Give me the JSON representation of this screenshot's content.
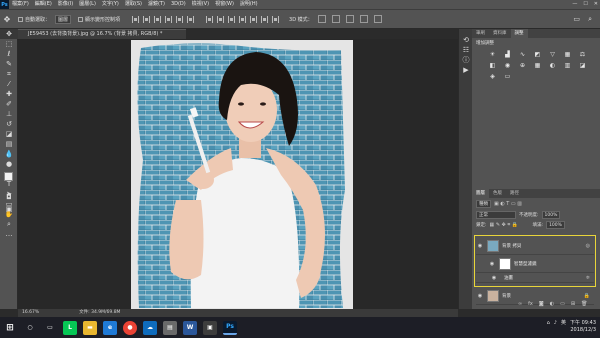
{
  "menubar": {
    "logo": "Ps",
    "items": [
      "檔案(F)",
      "編輯(E)",
      "影像(I)",
      "圖層(L)",
      "文字(Y)",
      "選取(S)",
      "濾鏡(T)",
      "3D(D)",
      "檢視(V)",
      "視窗(W)",
      "說明(H)"
    ],
    "window_controls": [
      "—",
      "☐",
      "✕"
    ]
  },
  "optionsbar": {
    "auto_select_label": "自動選取：",
    "auto_select_value": "圖層",
    "show_transform_label": "顯示變形控制項",
    "mode_label": "3D 模式："
  },
  "document": {
    "tab_title": "JE59453 (去背換背景).jpg @ 16.7% (背景 拷貝, RGB/8) *",
    "zoom": "16.67%",
    "doc_size": "文件: 34.9M/69.8M"
  },
  "panels": {
    "top_tabs": [
      "筆刷",
      "資料庫",
      "調整"
    ],
    "top_active": "調整",
    "adjust_title": "增加調整",
    "layer_tabs": [
      "圖層",
      "色版",
      "路徑"
    ],
    "layer_kind": "種類",
    "blend_mode": "正常",
    "opacity_label": "不透明度:",
    "opacity_value": "100%",
    "lock_label": "鎖定:",
    "fill_label": "填滿:",
    "fill_value": "100%",
    "layers": [
      {
        "name": "背景 拷貝"
      },
      {
        "name": "智慧型濾鏡"
      },
      {
        "name": "油畫"
      },
      {
        "name": "背景"
      }
    ],
    "highlight_color": "#e8d53a"
  },
  "taskbar": {
    "time": "下午 09:43",
    "date": "2018/12/3",
    "lang": "英",
    "apps": [
      {
        "icon": "search-icon",
        "color": "#1d1e26"
      },
      {
        "icon": "task-view-icon",
        "color": "#1d1e26"
      },
      {
        "icon": "line-app-icon",
        "color": "#06c755"
      },
      {
        "icon": "file-explorer-icon",
        "color": "#e9b730"
      },
      {
        "icon": "edge-icon",
        "color": "#1f7ad6"
      },
      {
        "icon": "chrome-icon",
        "color": "#ea4335"
      },
      {
        "icon": "onedrive-icon",
        "color": "#0f6cbd"
      },
      {
        "icon": "word-icon",
        "color": "#2b579a"
      },
      {
        "icon": "photoshop-icon",
        "color": "#0a1a2e"
      }
    ]
  }
}
